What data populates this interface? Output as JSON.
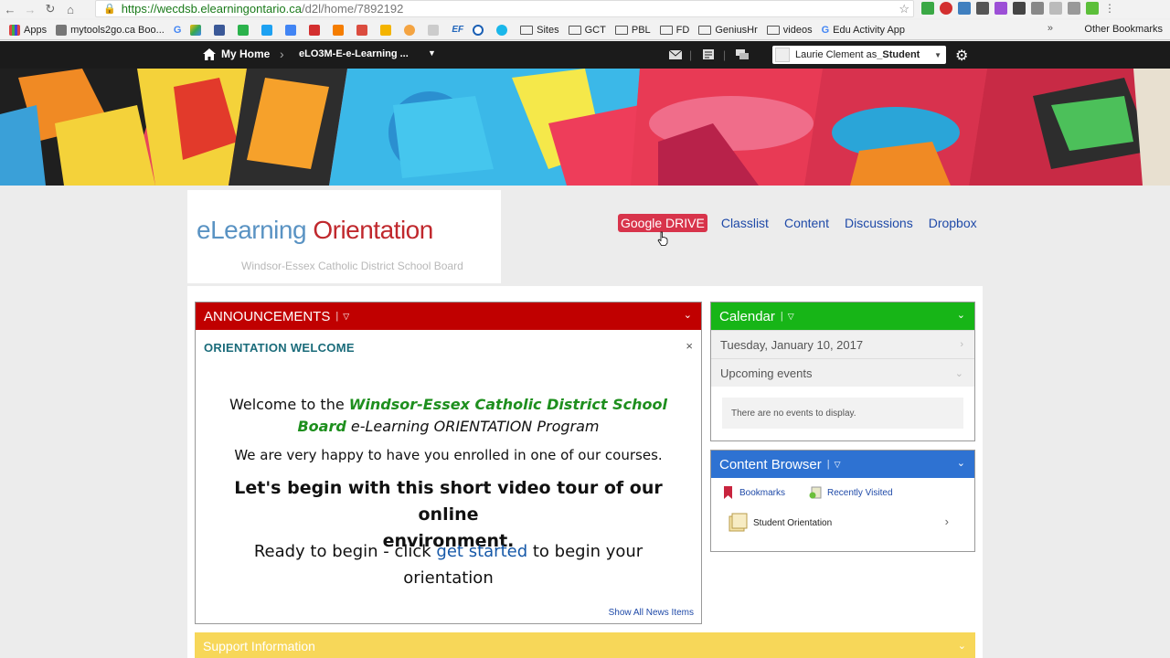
{
  "browser": {
    "url_host": "https://wecdsb.elearningontario.ca",
    "url_path": "/d2l/home/7892192",
    "bookmarks": [
      "Apps",
      "mytools2go.ca Boo...",
      "Sites",
      "GCT",
      "PBL",
      "FD",
      "GeniusHr",
      "videos",
      "Edu Activity App"
    ],
    "other_bookmarks": "Other Bookmarks"
  },
  "navbar": {
    "home": "My Home",
    "course": "eLO3M-E-e-Learning ...",
    "user": "Laurie Clement as ",
    "role": "_Student"
  },
  "logo": {
    "part1": "eLearning",
    "part2": " Orientation",
    "subtitle": "Windsor-Essex Catholic District School Board"
  },
  "tabs": [
    "Google DRIVE",
    "Classlist",
    "Content",
    "Discussions",
    "Dropbox"
  ],
  "announcements": {
    "header": "ANNOUNCEMENTS",
    "title": "ORIENTATION WELCOME",
    "welcome_pre": "Welcome to the ",
    "welcome_board_line1": "Windsor-Essex Catholic District School",
    "welcome_board_line2": "Board",
    "welcome_post": " e-Learning ORIENTATION Program",
    "happy": "We are very happy to have you enrolled in one of our courses.",
    "begin_line1": "Let's begin with this short video tour of our online",
    "begin_line2": "environment.",
    "ready_pre": "Ready to begin - click ",
    "ready_link": "get started",
    "ready_post": " to begin your",
    "ready_line2": "orientation",
    "show_all": "Show All News Items"
  },
  "calendar": {
    "header": "Calendar",
    "date": "Tuesday, January 10, 2017",
    "upcoming": "Upcoming events",
    "empty": "There are no events to display."
  },
  "content_browser": {
    "header": "Content Browser",
    "bookmarks": "Bookmarks",
    "recent": "Recently Visited",
    "item": "Student Orientation"
  },
  "support": {
    "header": "Support Information"
  },
  "colors": {
    "announcements": "#c00000",
    "calendar": "#17b517",
    "content_browser": "#2e72d2",
    "support": "#f7d759",
    "active_tab": "#d8344b"
  }
}
